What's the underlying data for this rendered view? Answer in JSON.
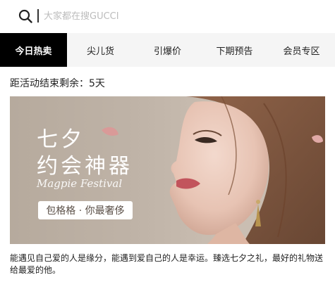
{
  "search": {
    "placeholder": "大家都在搜GUCCI",
    "icon": "search-icon"
  },
  "tabs": [
    {
      "label": "今日热卖",
      "active": true
    },
    {
      "label": "尖儿货",
      "active": false
    },
    {
      "label": "引爆价",
      "active": false
    },
    {
      "label": "下期预告",
      "active": false
    },
    {
      "label": "会员专区",
      "active": false
    }
  ],
  "countdown": {
    "text": "距活动结束剩余：5天"
  },
  "banner": {
    "title_line1": "七夕",
    "title_line2": "约会神器",
    "script_text": "Magpie Festival",
    "pill_text": "包格格 · 你最奢侈"
  },
  "description": "能遇见自己爱的人是缘分，能遇到爱自己的人是幸运。臻选七夕之礼，最好的礼物送给最爱的他。",
  "colors": {
    "tab_active_bg": "#000000",
    "tab_bar_bg": "#f5f5f5"
  }
}
